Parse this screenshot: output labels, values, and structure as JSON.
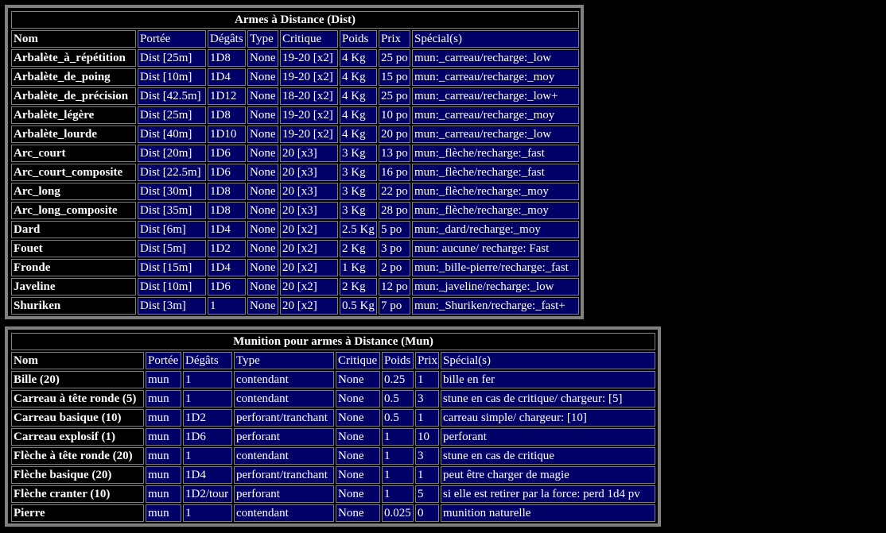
{
  "dist": {
    "title": "Armes à Distance (Dist)",
    "headers": [
      "Nom",
      "Portée",
      "Dégâts",
      "Type",
      "Critique",
      "Poids",
      "Prix",
      "Spécial(s)"
    ],
    "rows": [
      [
        "Arbalète_à_répétition",
        "Dist [25m]",
        "1D8",
        "None",
        "19-20 [x2]",
        "4 Kg",
        "25 po",
        "mun:_carreau/recharge:_low"
      ],
      [
        "Arbalète_de_poing",
        "Dist [10m]",
        "1D4",
        "None",
        "19-20 [x2]",
        "4 Kg",
        "15 po",
        "mun:_carreau/recharge:_moy"
      ],
      [
        "Arbalète_de_précision",
        "Dist [42.5m]",
        "1D12",
        "None",
        "18-20 [x2]",
        "4 Kg",
        "25 po",
        "mun:_carreau/recharge:_low+"
      ],
      [
        "Arbalète_légère",
        "Dist [25m]",
        "1D8",
        "None",
        "19-20 [x2]",
        "4 Kg",
        "10 po",
        "mun:_carreau/recharge:_moy"
      ],
      [
        "Arbalète_lourde",
        "Dist [40m]",
        "1D10",
        "None",
        "19-20 [x2]",
        "4 Kg",
        "20 po",
        "mun:_carreau/recharge:_low"
      ],
      [
        "Arc_court",
        "Dist [20m]",
        "1D6",
        "None",
        "20 [x3]",
        "3 Kg",
        "13 po",
        "mun:_flèche/recharge:_fast"
      ],
      [
        "Arc_court_composite",
        "Dist [22.5m]",
        "1D6",
        "None",
        "20 [x3]",
        "3 Kg",
        "16 po",
        "mun:_flèche/recharge:_fast"
      ],
      [
        "Arc_long",
        "Dist [30m]",
        "1D8",
        "None",
        "20 [x3]",
        "3 Kg",
        "22 po",
        "mun:_flèche/recharge:_moy"
      ],
      [
        "Arc_long_composite",
        "Dist [35m]",
        "1D8",
        "None",
        "20 [x3]",
        "3 Kg",
        "28 po",
        "mun:_flèche/recharge:_moy"
      ],
      [
        "Dard",
        "Dist [6m]",
        "1D4",
        "None",
        "20 [x2]",
        "2.5 Kg",
        "5 po",
        "mun:_dard/recharge:_moy"
      ],
      [
        "Fouet",
        "Dist [5m]",
        "1D2",
        "None",
        "20 [x2]",
        "2 Kg",
        "3 po",
        "mun: aucune/ recharge: Fast"
      ],
      [
        "Fronde",
        "Dist [15m]",
        "1D4",
        "None",
        "20 [x2]",
        "1 Kg",
        "2 po",
        "mun:_bille-pierre/recharge:_fast"
      ],
      [
        "Javeline",
        "Dist [10m]",
        "1D6",
        "None",
        "20 [x2]",
        "2 Kg",
        "12 po",
        "mun:_javeline/recharge:_low"
      ],
      [
        "Shuriken",
        "Dist [3m]",
        "1",
        "None",
        "20 [x2]",
        "0.5 Kg",
        "7 po",
        "mun:_Shuriken/recharge:_fast+"
      ]
    ]
  },
  "mun": {
    "title": "Munition pour armes à Distance (Mun)",
    "headers": [
      "Nom",
      "Portée",
      "Dégâts",
      "Type",
      "Critique",
      "Poids",
      "Prix",
      "Spécial(s)"
    ],
    "rows": [
      [
        "Bille (20)",
        "mun",
        "1",
        "contendant",
        "None",
        "0.25",
        "1",
        "bille en fer"
      ],
      [
        "Carreau à tête ronde (5)",
        "mun",
        "1",
        "contendant",
        "None",
        "0.5",
        "3",
        "stune en cas de critique/ chargeur: [5]"
      ],
      [
        "Carreau basique (10)",
        "mun",
        "1D2",
        "perforant/tranchant",
        "None",
        "0.5",
        "1",
        "carreau simple/ chargeur: [10]"
      ],
      [
        "Carreau explosif (1)",
        "mun",
        "1D6",
        "perforant",
        "None",
        "1",
        "10",
        "perforant"
      ],
      [
        "Flèche à tête ronde (20)",
        "mun",
        "1",
        "contendant",
        "None",
        "1",
        "3",
        "stune en cas de critique"
      ],
      [
        "Flèche basique (20)",
        "mun",
        "1D4",
        "perforant/tranchant",
        "None",
        "1",
        "1",
        "peut être charger de magie"
      ],
      [
        "Flèche cranter (10)",
        "mun",
        "1D2/tour",
        "perforant",
        "None",
        "1",
        "5",
        "si elle est retirer par la force: perd 1d4 pv"
      ],
      [
        "Pierre",
        "mun",
        "1",
        "contendant",
        "None",
        "0.025",
        "0",
        "munition naturelle"
      ]
    ]
  },
  "colors": {
    "cell_background": "#000066",
    "page_background": "#000000",
    "frame_border": "#808080",
    "text": "#ffffff"
  }
}
